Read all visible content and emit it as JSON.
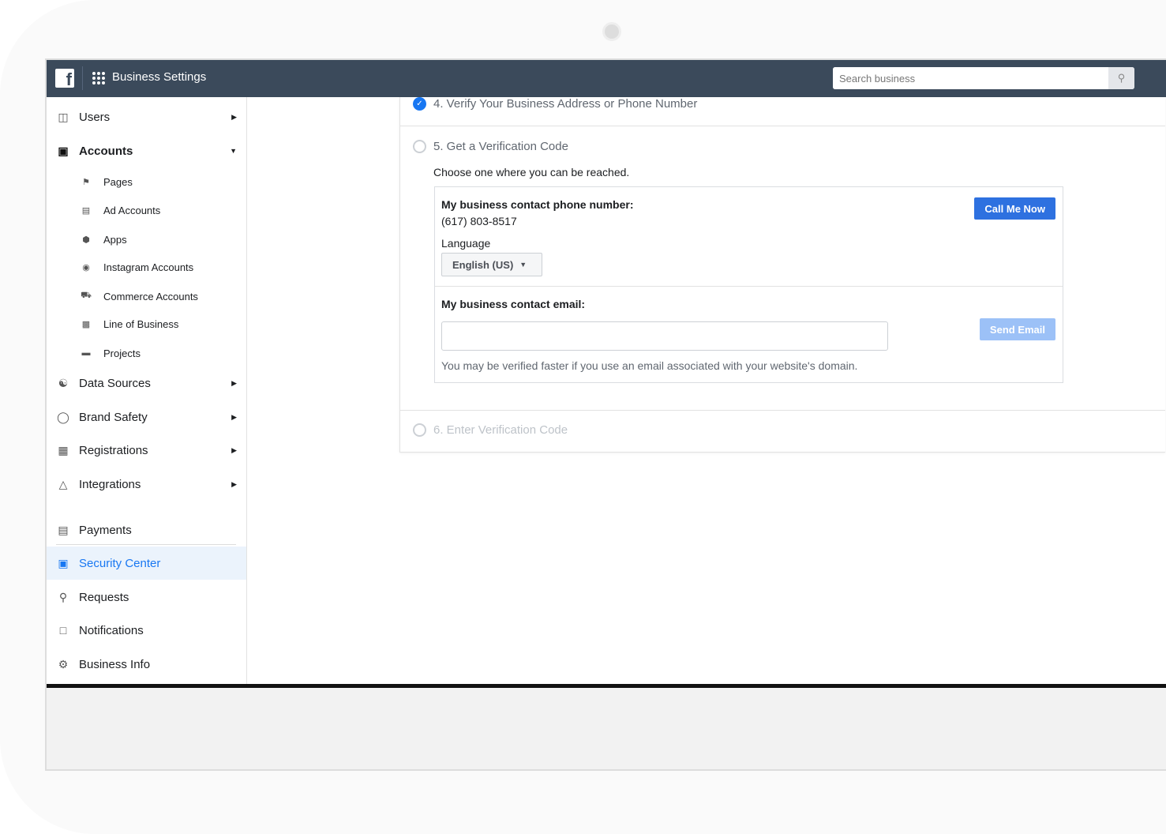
{
  "header": {
    "title": "Business Settings",
    "logo": "f",
    "search_placeholder": "Search business"
  },
  "sidebar": {
    "groups": [
      {
        "label": "Users",
        "icon": "users-icon"
      },
      {
        "label": "Accounts",
        "icon": "archive-icon"
      },
      {
        "label": "Data Sources",
        "icon": "data-sources-icon"
      },
      {
        "label": "Brand Safety",
        "icon": "shield-icon"
      },
      {
        "label": "Registrations",
        "icon": "clipboard-icon"
      },
      {
        "label": "Integrations",
        "icon": "integrations-icon"
      }
    ],
    "accounts_items": [
      {
        "label": "Pages",
        "icon": "flag-icon"
      },
      {
        "label": "Ad Accounts",
        "icon": "ad-account-icon"
      },
      {
        "label": "Apps",
        "icon": "cube-icon"
      },
      {
        "label": "Instagram Accounts",
        "icon": "instagram-icon"
      },
      {
        "label": "Commerce Accounts",
        "icon": "cart-icon"
      },
      {
        "label": "Line of Business",
        "icon": "briefcase-icon"
      },
      {
        "label": "Projects",
        "icon": "folder-icon"
      }
    ],
    "bottom_items": [
      {
        "label": "Payments",
        "icon": "bank-icon"
      },
      {
        "label": "Security Center",
        "icon": "lock-icon",
        "active": true
      },
      {
        "label": "Requests",
        "icon": "key-icon"
      },
      {
        "label": "Notifications",
        "icon": "notification-icon"
      },
      {
        "label": "Business Info",
        "icon": "gear-icon"
      }
    ]
  },
  "main": {
    "step4": "4. Verify Your Business Address or Phone Number",
    "step5": "5. Get a Verification Code",
    "step5_hint": "Choose one where you can be reached.",
    "phone_label": "My business contact phone number:",
    "phone_value": "(617) 803-8517",
    "language_label": "Language",
    "language_value": "English (US)",
    "call_button": "Call Me Now",
    "email_label": "My business contact email:",
    "email_value": "",
    "send_button": "Send Email",
    "email_hint": "You may be verified faster if you use an email associated with your website's domain.",
    "step6": "6. Enter Verification Code"
  },
  "colors": {
    "header": "#3b4a5b",
    "accent": "#1877f2",
    "accent_disabled": "#9cc1f7"
  }
}
